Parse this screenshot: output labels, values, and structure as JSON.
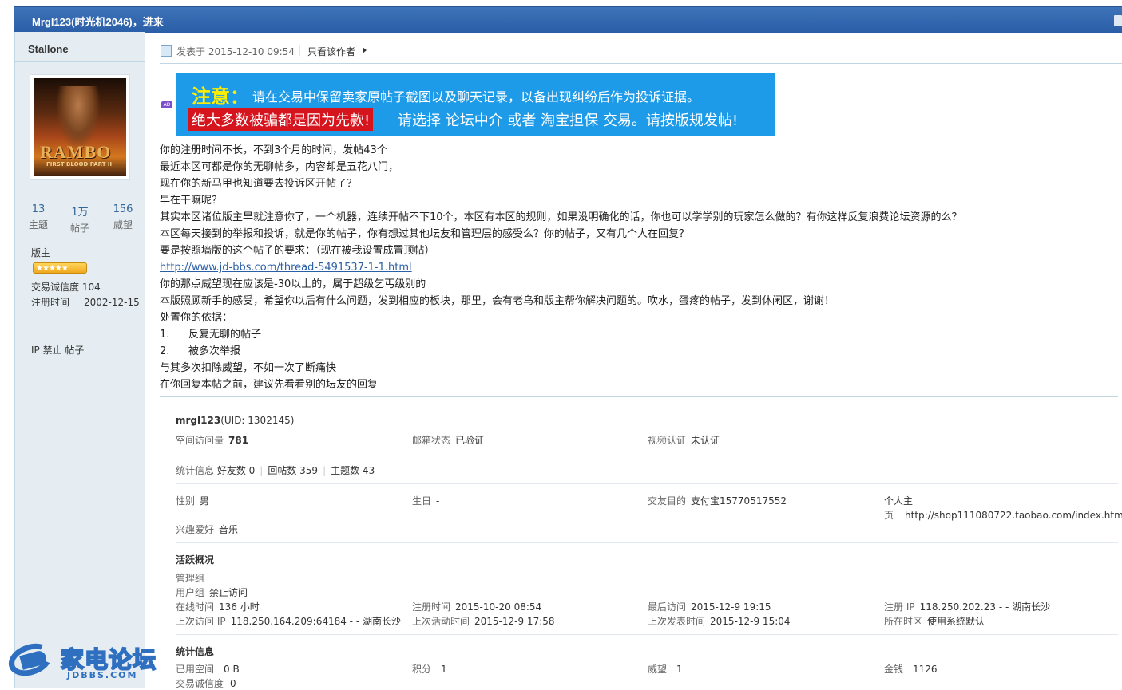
{
  "header": {
    "title": "Mrgl123(时光机2046)，进来"
  },
  "sidebar": {
    "username": "Stallone",
    "avatar": {
      "text": "RAMBO",
      "sub": "FIRST BLOOD PART II"
    },
    "stats": [
      {
        "num": "13",
        "label": "主题"
      },
      {
        "num": "1万",
        "label": "帖子"
      },
      {
        "num": "156",
        "label": "威望"
      }
    ],
    "group": "版主",
    "stars": "★★★★★",
    "credit": "交易诚信度 104",
    "reg_label": "注册时间",
    "reg_value": "2002-12-15",
    "ipban": "IP 禁止 帖子"
  },
  "logo": {
    "cn": "家电论坛",
    "en": "JDBBS.COM"
  },
  "post": {
    "meta": "发表于 2015-12-10 09:54",
    "sep": "|",
    "only_author": "只看该作者",
    "ad_tag": "AD",
    "banner": {
      "notice_word": "注意：",
      "line1": "请在交易中保留卖家原帖子截图以及聊天记录，以备出现纠纷后作为投诉证据。",
      "red": "绝大多数被骗都是因为先款!",
      "line2": "请选择 论坛中介 或者 淘宝担保 交易。请按版规发帖!"
    },
    "lines": [
      "你的注册时间不长，不到3个月的时间，发帖43个",
      "最近本区可都是你的无聊帖多，内容却是五花八门，",
      "现在你的新马甲也知道要去投诉区开帖了？",
      "早在干嘛呢？",
      "其实本区诸位版主早就注意你了，一个机器，连续开帖不下10个，本区有本区的规则，如果没明确化的话，你也可以学学别的玩家怎么做的？有你这样反复浪费论坛资源的么？",
      "本区每天接到的举报和投诉，就是你的帖子，你有想过其他坛友和管理层的感受么？你的帖子，又有几个人在回复？",
      "要是按照墙版的这个帖子的要求：（现在被我设置成置顶帖）"
    ],
    "link": "http://www.jd-bbs.com/thread-5491537-1-1.html",
    "lines2": [
      "你的那点威望现在应该是-30以上的，属于超级乞丐级别的",
      "本版照顾新手的感受，希望你以后有什么问题，发到相应的板块，那里，会有老鸟和版主帮你解决问题的。吹水，蛋疼的帖子，发到休闲区，谢谢！",
      "处置你的依据："
    ],
    "list": [
      {
        "n": "1.",
        "t": "反复无聊的帖子"
      },
      {
        "n": "2.",
        "t": "被多次举报"
      }
    ],
    "lines3": [
      "与其多次扣除威望，不如一次了断痛快",
      "在你回复本帖之前，建议先看看别的坛友的回复"
    ]
  },
  "profile": {
    "name": "mrgl123",
    "uid": "(UID: 1302145)",
    "visits_label": "空间访问量",
    "visits": "781",
    "email_label": "邮箱状态",
    "email": "已验证",
    "video_label": "视频认证",
    "video": "未认证",
    "stats_label": "统计信息",
    "friends": "好友数 0",
    "replies": "回帖数 359",
    "topics": "主题数 43",
    "gender_label": "性别",
    "gender": "男",
    "birthday_label": "生日",
    "birthday": "-",
    "purpose_label": "交友目的",
    "purpose": "支付宝15770517552",
    "homepage_label1": "个人主",
    "homepage_label2": "页",
    "homepage": "http://shop111080722.taobao.com/index.htm",
    "hobby_label": "兴趣爱好",
    "hobby": "音乐",
    "activity_title": "活跃概况",
    "admin_group_label": "管理组",
    "user_group_label": "用户组",
    "user_group": "禁止访问",
    "online_label": "在线时间",
    "online": "136 小时",
    "reg_label": "注册时间",
    "reg": "2015-10-20 08:54",
    "last_visit_label": "最后访问",
    "last_visit": "2015-12-9 19:15",
    "reg_ip_label": "注册 IP",
    "reg_ip": "118.250.202.23 - - 湖南长沙",
    "last_ip_label": "上次访问 IP",
    "last_ip": "118.250.164.209:64184 - - 湖南长沙",
    "last_active_label": "上次活动时间",
    "last_active": "2015-12-9 17:58",
    "last_post_label": "上次发表时间",
    "last_post": "2015-12-9 15:04",
    "timezone_label": "所在时区",
    "timezone": "使用系统默认",
    "stat_title": "统计信息",
    "space_label": "已用空间",
    "space": "0 B",
    "points_label": "积分",
    "points": "1",
    "prestige_label": "威望",
    "prestige": "1",
    "money_label": "金钱",
    "money": "1126",
    "trust_label": "交易诚信度",
    "trust": "0"
  }
}
